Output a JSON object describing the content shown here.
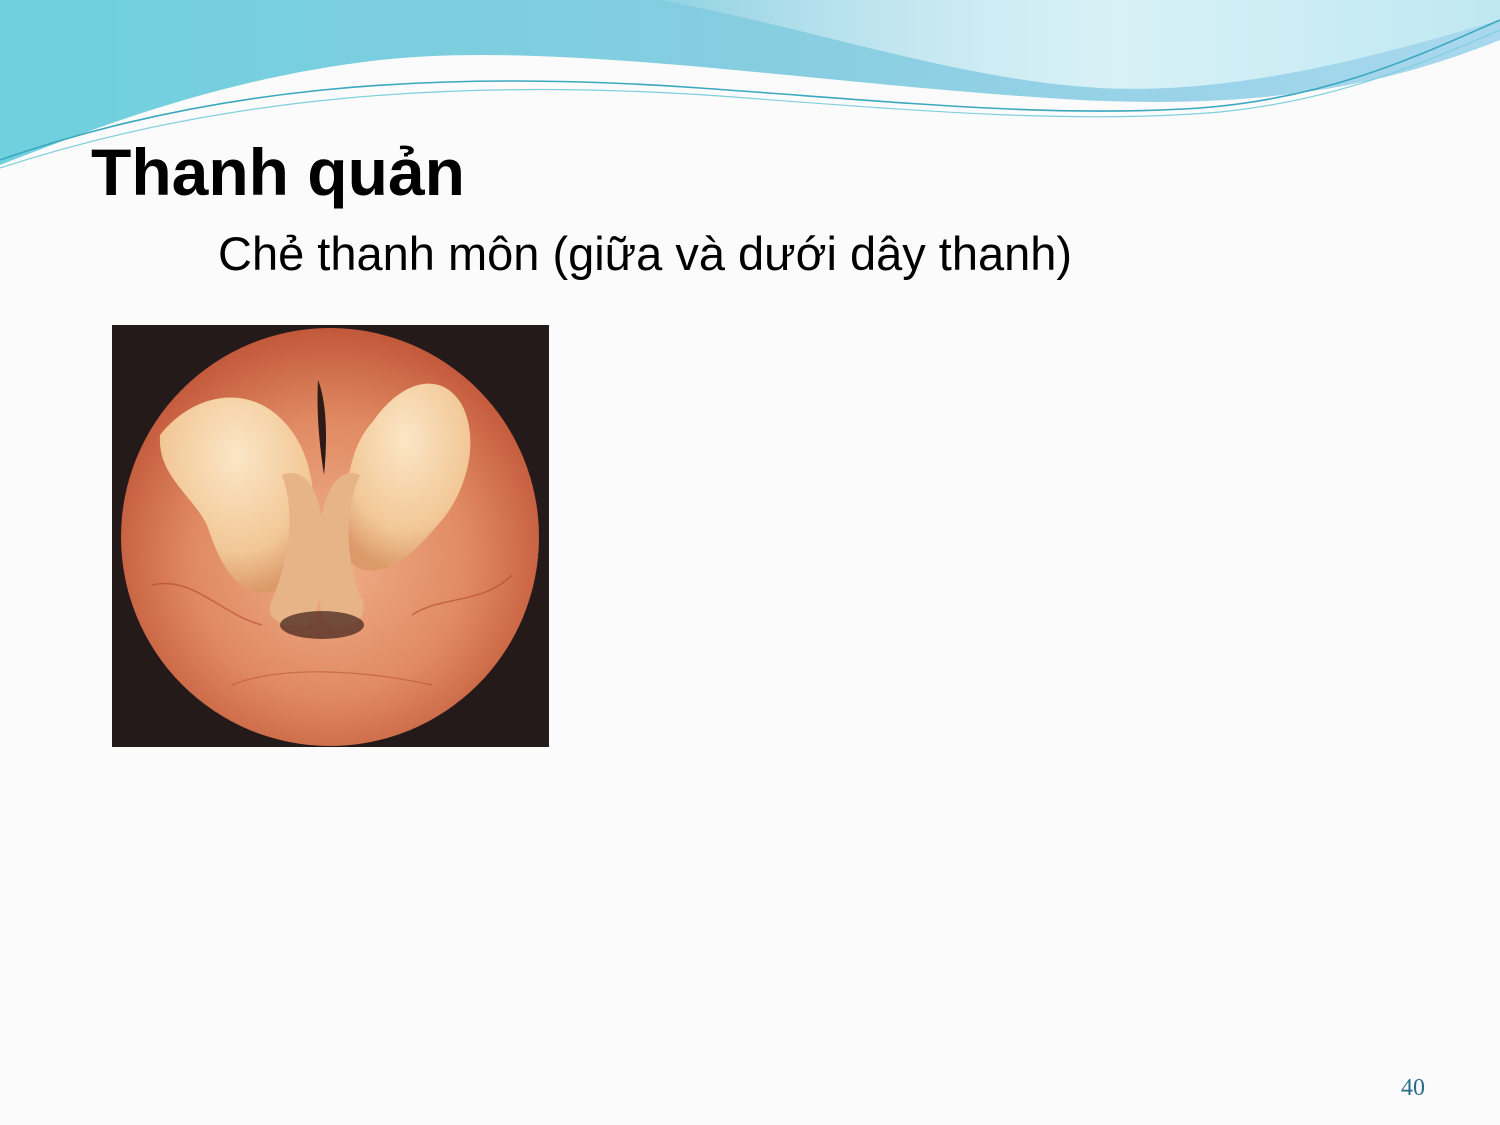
{
  "slide": {
    "title": "Thanh quản",
    "subtitle": "Chẻ thanh môn (giữa và dưới dây thanh)",
    "page_number": "40",
    "photo": {
      "subject": "laryngoscopy-photo"
    },
    "colors": {
      "wave_dark": "#5fc7d6",
      "wave_light": "#b7e6ee",
      "page_number": "#2a6b8a",
      "background": "#fbfbfb"
    }
  }
}
